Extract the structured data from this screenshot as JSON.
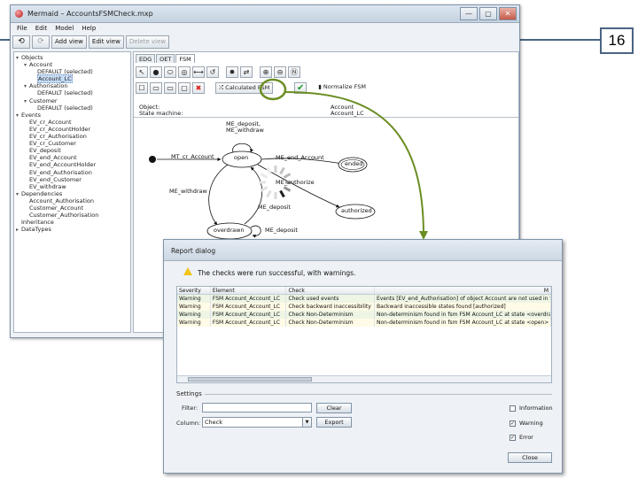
{
  "slide": {
    "number": "16"
  },
  "window": {
    "title": "Mermaid – AccountsFSMCheck.mxp",
    "buttons": {
      "minimize": "—",
      "maximize": "▢",
      "close": "✕"
    }
  },
  "menu": [
    "File",
    "Edit",
    "Model",
    "Help"
  ],
  "toolbar": {
    "undo": "⟲",
    "redo": "⟳",
    "add_view": "Add view",
    "edit_view": "Edit view",
    "delete_view": "Delete view"
  },
  "tree": [
    {
      "depth": 0,
      "exp": "▾",
      "label": "Objects"
    },
    {
      "depth": 1,
      "exp": "▾",
      "label": "Account"
    },
    {
      "depth": 2,
      "exp": "",
      "label": "DEFAULT (selected)"
    },
    {
      "depth": 2,
      "exp": "",
      "label": "Account_LC",
      "selected": true
    },
    {
      "depth": 1,
      "exp": "▾",
      "label": "Authorisation"
    },
    {
      "depth": 2,
      "exp": "",
      "label": "DEFAULT (selected)"
    },
    {
      "depth": 1,
      "exp": "▾",
      "label": "Customer"
    },
    {
      "depth": 2,
      "exp": "",
      "label": "DEFAULT (selected)"
    },
    {
      "depth": 0,
      "exp": "▾",
      "label": "Events"
    },
    {
      "depth": 1,
      "exp": "",
      "label": "EV_cr_Account"
    },
    {
      "depth": 1,
      "exp": "",
      "label": "EV_cr_AccountHolder"
    },
    {
      "depth": 1,
      "exp": "",
      "label": "EV_cr_Authorisation"
    },
    {
      "depth": 1,
      "exp": "",
      "label": "EV_cr_Customer"
    },
    {
      "depth": 1,
      "exp": "",
      "label": "EV_deposit"
    },
    {
      "depth": 1,
      "exp": "",
      "label": "EV_end_Account"
    },
    {
      "depth": 1,
      "exp": "",
      "label": "EV_end_AccountHolder"
    },
    {
      "depth": 1,
      "exp": "",
      "label": "EV_end_Authorisation"
    },
    {
      "depth": 1,
      "exp": "",
      "label": "EV_end_Customer"
    },
    {
      "depth": 1,
      "exp": "",
      "label": "EV_withdraw"
    },
    {
      "depth": 0,
      "exp": "▾",
      "label": "Dependencies"
    },
    {
      "depth": 1,
      "exp": "",
      "label": "Account_Authorisation"
    },
    {
      "depth": 1,
      "exp": "",
      "label": "Customer_Account"
    },
    {
      "depth": 1,
      "exp": "",
      "label": "Customer_Authorisation"
    },
    {
      "depth": 0,
      "exp": "",
      "label": "Inheritance"
    },
    {
      "depth": 0,
      "exp": "▸",
      "label": "DataTypes"
    }
  ],
  "editor": {
    "tabs": [
      "EDG",
      "OET",
      "FSM"
    ],
    "calc_label": "Calculated FSM",
    "normalize_label": "Normalize FSM",
    "info": {
      "object_label": "Object:",
      "object_value": "Account",
      "sm_label": "State machine:",
      "sm_value": "Account_LC"
    }
  },
  "fsm": {
    "states": {
      "open": "open",
      "ended": "ended",
      "overdrawn": "overdrawn",
      "authorized": "authorized"
    },
    "labels": {
      "loop_open": "ME_deposit,\nME_withdraw",
      "create": "MT_cr_Account",
      "end": "ME_end_Account",
      "overdraw": "ME_withdraw",
      "authorize": "ME_authorize",
      "repay": "ME_deposit",
      "loop_over": "ME_deposit"
    }
  },
  "dialog": {
    "title": "Report dialog",
    "message": "The checks were run successful, with warnings.",
    "columns": [
      "Severity",
      "Element",
      "Check",
      "M"
    ],
    "rows": [
      [
        "Warning",
        "FSM Account_Account_LC",
        "Check used events",
        "Events [EV_end_Authorisation] of object Account are not used in this"
      ],
      [
        "Warning",
        "FSM Account_Account_LC",
        "Check backward inaccessibility",
        "Backward inaccessible states found [authorized]"
      ],
      [
        "Warning",
        "FSM Account_Account_LC",
        "Check Non-Determinism",
        "Non-determinism found in fsm FSM Account_LC at state <overdrawn>"
      ],
      [
        "Warning",
        "FSM Account_Account_LC",
        "Check Non-Determinism",
        "Non-determinism found in fsm FSM Account_LC at state <open> for"
      ]
    ],
    "settings_label": "Settings",
    "filter_label": "Filter:",
    "filter_value": "",
    "clear_label": "Clear",
    "column_label": "Column:",
    "column_value": "Check",
    "export_label": "Export",
    "checks": [
      {
        "label": "Information",
        "checked": false
      },
      {
        "label": "Warning",
        "checked": true
      },
      {
        "label": "Error",
        "checked": true
      }
    ],
    "close_label": "Close"
  },
  "colors": {
    "accent_line": "#4a6582",
    "highlight_circle": "#6b8e23",
    "check_green": "#1b9a26"
  }
}
